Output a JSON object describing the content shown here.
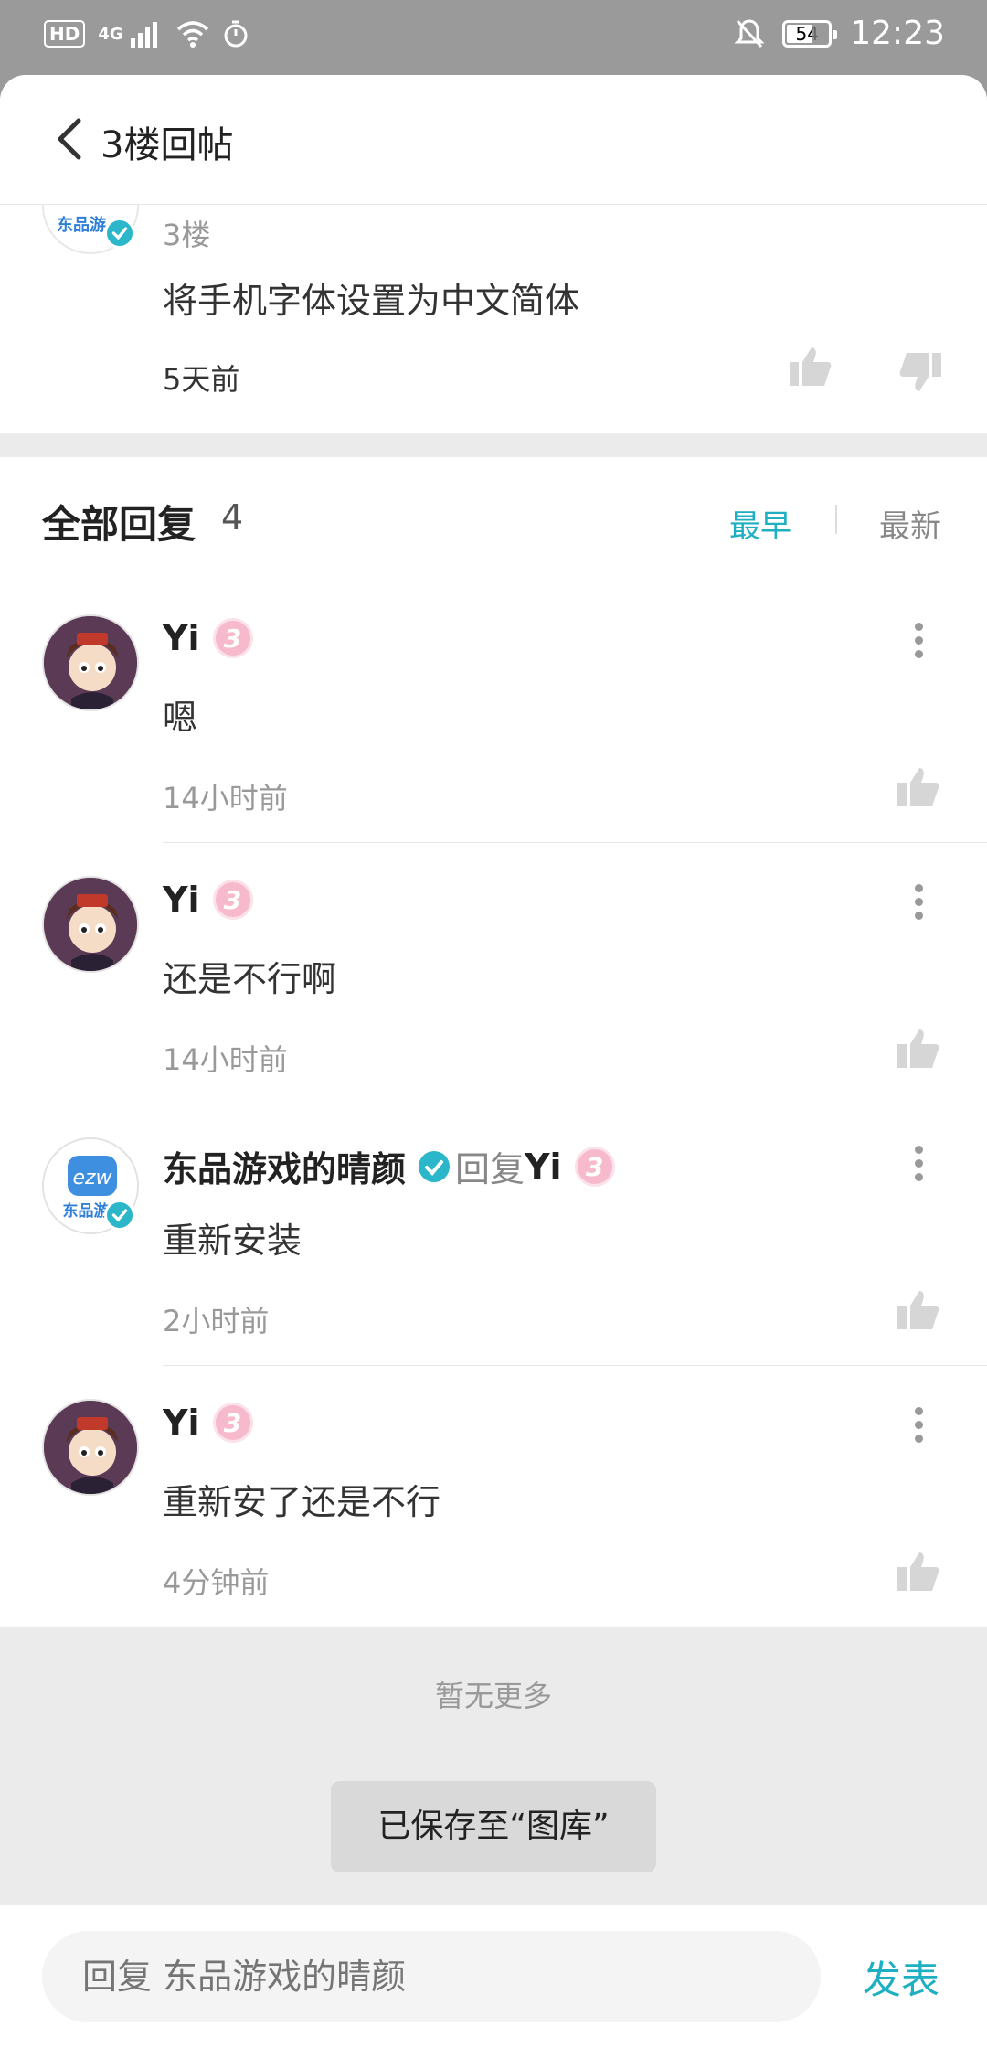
{
  "status_bar": {
    "hd": "HD",
    "network": "4G",
    "battery": "54",
    "time": "12:23"
  },
  "header": {
    "title": "3楼回帖"
  },
  "floor_post": {
    "brand_text": "东品游",
    "floor_label": "3楼",
    "content": "将手机字体设置为中文简体",
    "time": "5天前"
  },
  "replies_header": {
    "title": "全部回复",
    "count": "4",
    "sort_earliest": "最早",
    "sort_latest": "最新"
  },
  "replies": [
    {
      "name": "Yi",
      "level": "3",
      "content": "嗯",
      "time": "14小时前"
    },
    {
      "name": "Yi",
      "level": "3",
      "content": "还是不行啊",
      "time": "14小时前"
    },
    {
      "name": "东品游戏的晴颜",
      "reply_label": "回复",
      "reply_to": "Yi",
      "level": "3",
      "brand_logo": "ezw",
      "brand_text": "东品游",
      "content": "重新安装",
      "time": "2小时前"
    },
    {
      "name": "Yi",
      "level": "3",
      "content": "重新安了还是不行",
      "time": "4分钟前"
    }
  ],
  "footer": {
    "no_more": "暂无更多",
    "toast": "已保存至“图库”"
  },
  "input_bar": {
    "placeholder": "回复 东品游戏的晴颜",
    "send_label": "发表"
  },
  "colors": {
    "accent": "#1eb0c2",
    "verified": "#2bb7c9",
    "level_badge": "#f7b9cc"
  }
}
